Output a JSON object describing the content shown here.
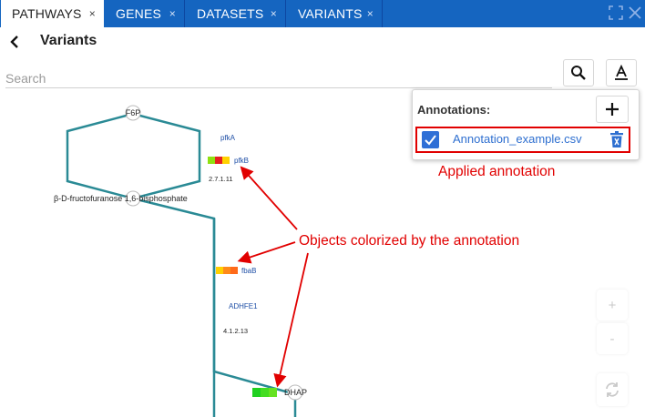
{
  "tabs": [
    {
      "label": "PATHWAYS",
      "active": true
    },
    {
      "label": "GENES",
      "active": false
    },
    {
      "label": "DATASETS",
      "active": false
    },
    {
      "label": "VARIANTS",
      "active": false
    }
  ],
  "tab_close_glyph": "×",
  "header": {
    "title": "Variants"
  },
  "search": {
    "placeholder": "Search",
    "value": ""
  },
  "icons": [
    "chevron-left-icon",
    "search-icon",
    "text-format-icon",
    "plus-icon",
    "checkbox-checked-icon",
    "trash-icon",
    "fullscreen-icon",
    "close-icon",
    "zoom-in-icon",
    "zoom-out-icon",
    "refresh-icon"
  ],
  "annotations": {
    "title": "Annotations:",
    "items": [
      {
        "filename": "Annotation_example.csv",
        "checked": true
      }
    ]
  },
  "callouts": {
    "applied": "Applied annotation",
    "objects": "Objects colorized by the annotation"
  },
  "pathway": {
    "metabolites": [
      "F6P",
      "β-D-fructofuranose 1,6-bisphosphate",
      "DHAP"
    ],
    "genes": [
      "pfkA",
      "pfkB",
      "fbaB",
      "ADHFE1"
    ],
    "ec_numbers": [
      "2.7.1.11",
      "4.1.2.13"
    ],
    "annotation_colors": {
      "pfkB": [
        "#8fe010",
        "#e62020",
        "#ffd200"
      ],
      "fbaB": [
        "#ffd000",
        "#ff8a1a",
        "#ff6a1a"
      ],
      "DHAP": [
        "#20d020",
        "#44dd22",
        "#66e222"
      ]
    }
  },
  "side_controls": {
    "zoom_in": "+",
    "zoom_out": "-"
  },
  "colors": {
    "tabbar": "#1565c0",
    "path_line": "#2a8a95",
    "gene_text": "#1f4fa6",
    "annotation_highlight": "#e10000",
    "checkbox": "#2f6fd6"
  }
}
